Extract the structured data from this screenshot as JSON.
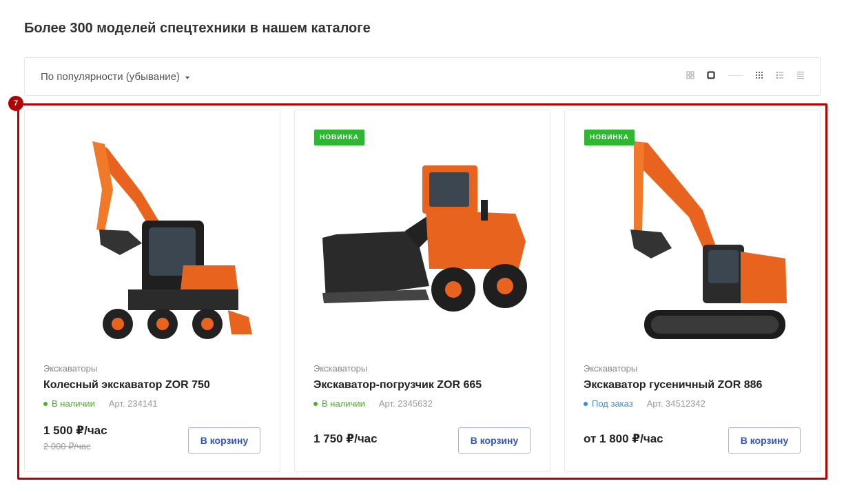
{
  "page": {
    "title": "Более 300 моделей спецтехники в нашем каталоге"
  },
  "toolbar": {
    "sort_label": "По популярности (убывание)",
    "views": [
      "grid-small-icon",
      "grid-large-icon",
      "grid-dots-icon",
      "list-icon",
      "lines-icon"
    ]
  },
  "selection": {
    "badge": "7"
  },
  "colors": {
    "in_stock": "#4cae2c",
    "on_order": "#2f8fd6",
    "badge_new": "#2fb633",
    "accent": "#2d55c8",
    "frame": "#b30000"
  },
  "products": [
    {
      "category": "Экскаваторы",
      "name": "Колесный экскаватор ZOR 750",
      "status": "В наличии",
      "article": "Арт. 234141",
      "price": "1 500 ₽/час",
      "old_price": "2 000 ₽/час",
      "button": "В корзину",
      "badge": ""
    },
    {
      "category": "Экскаваторы",
      "name": "Экскаватор-погрузчик ZOR 665",
      "status": "В наличии",
      "article": "Арт. 2345632",
      "price": "1 750 ₽/час",
      "button": "В корзину",
      "badge": "НОВИНКА"
    },
    {
      "category": "Экскаваторы",
      "name": "Экскаватор гусеничный ZOR 886",
      "status": "Под заказ",
      "article": "Арт. 34512342",
      "price": "от 1 800 ₽/час",
      "button": "В корзину",
      "badge": "НОВИНКА"
    }
  ]
}
